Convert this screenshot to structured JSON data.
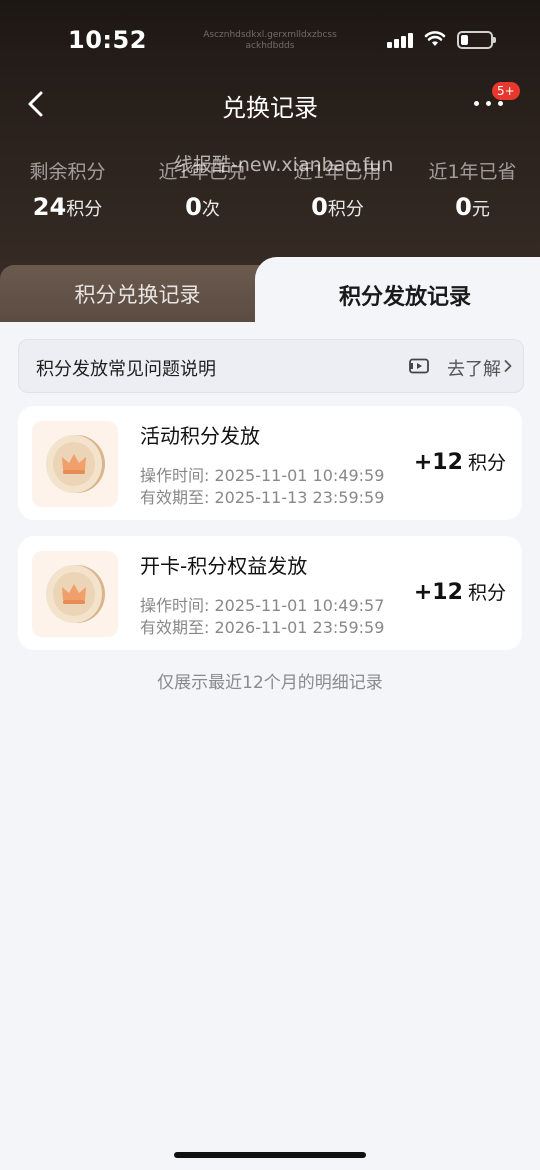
{
  "status": {
    "time": "10:52",
    "carrier": "Ascznhdsdkxl.gerxmlldxzbcss ackhdbdds"
  },
  "nav": {
    "title": "兑换记录",
    "badge": "5+"
  },
  "watermark": "线报酷-new.xianbao.fun",
  "stats": [
    {
      "label": "剩余积分",
      "value": "24",
      "unit": "积分"
    },
    {
      "label": "近1年已兑",
      "value": "0",
      "unit": "次"
    },
    {
      "label": "近1年已用",
      "value": "0",
      "unit": "积分"
    },
    {
      "label": "近1年已省",
      "value": "0",
      "unit": "元"
    }
  ],
  "tabs": {
    "exchange": "积分兑换记录",
    "issue": "积分发放记录"
  },
  "faq": {
    "label": "积分发放常见问题说明",
    "link": "去了解"
  },
  "records": [
    {
      "title": "活动积分发放",
      "op_time": "操作时间: 2025-11-01 10:49:59",
      "expire": "有效期至: 2025-11-13 23:59:59",
      "amount": "+12",
      "unit": "积分"
    },
    {
      "title": "开卡-积分权益发放",
      "op_time": "操作时间: 2025-11-01 10:49:57",
      "expire": "有效期至: 2026-11-01 23:59:59",
      "amount": "+12",
      "unit": "积分"
    }
  ],
  "footer_note": "仅展示最近12个月的明细记录",
  "colors": {
    "header_dark": "#2b221d",
    "tab_inactive": "#5a4a40",
    "badge": "#e8372c",
    "coin_bg": "#fdf3ea",
    "coin": "#e8c9a6"
  },
  "icons": [
    "back-chevron-icon",
    "more-dots-icon",
    "signal-icon",
    "wifi-icon",
    "battery-icon",
    "video-icon",
    "chevron-right-icon",
    "crown-coin-icon"
  ]
}
